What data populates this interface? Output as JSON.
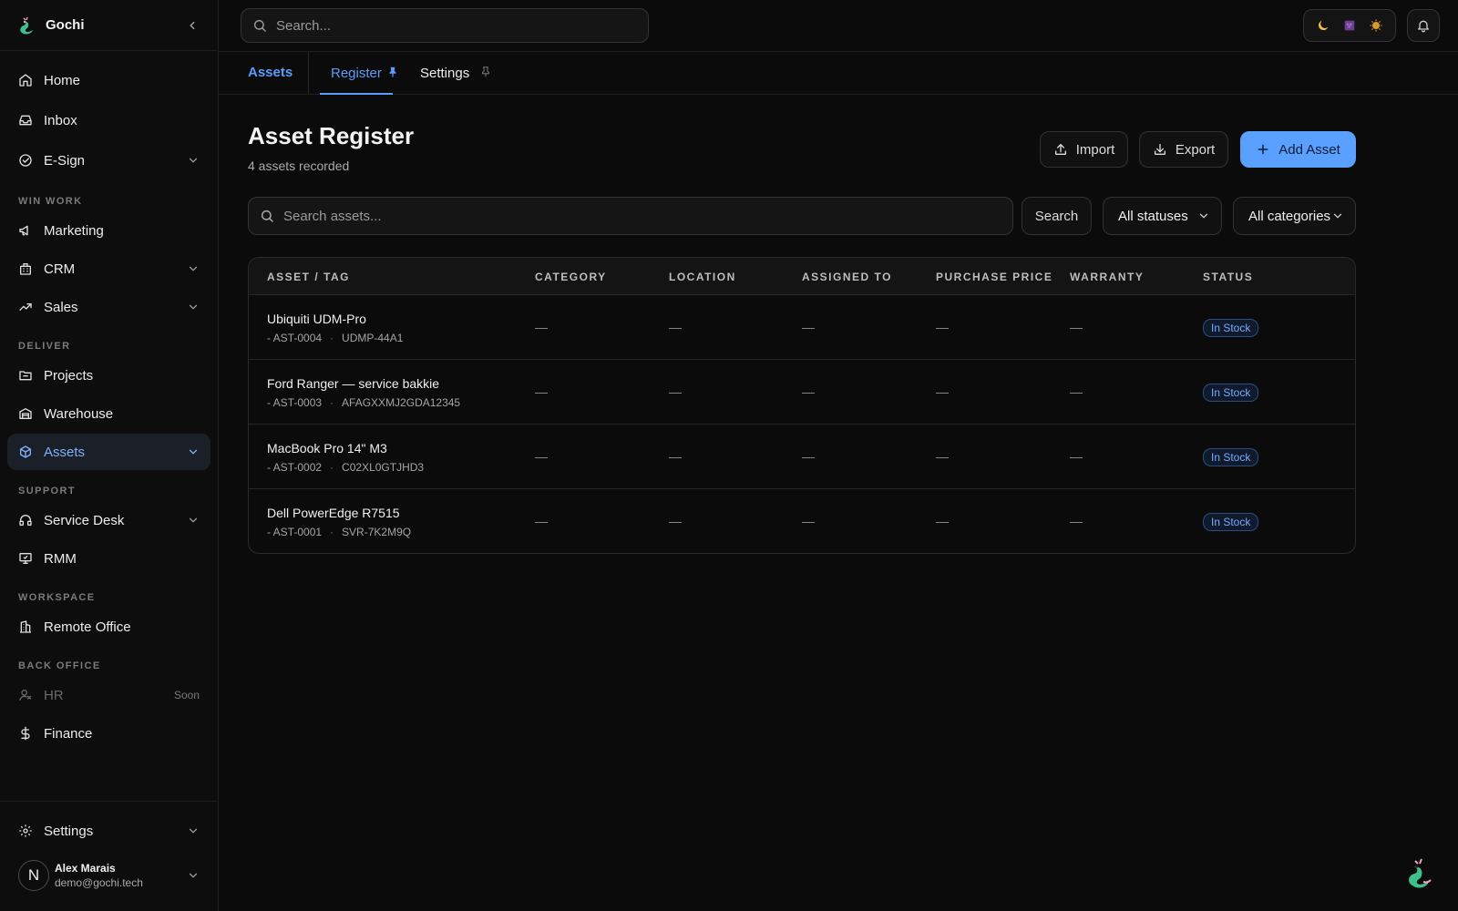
{
  "brand": {
    "name": "Gochi",
    "logo_icon": "dragon-logo-icon"
  },
  "sidebar": {
    "items": [
      {
        "label": "Home",
        "icon": "home-icon"
      },
      {
        "label": "Inbox",
        "icon": "inbox-icon"
      },
      {
        "label": "E-Sign",
        "icon": "check-circle-icon"
      },
      {
        "label": "Marketing",
        "icon": "megaphone-icon"
      },
      {
        "label": "CRM",
        "icon": "building-icon"
      },
      {
        "label": "Sales",
        "icon": "trending-up-icon"
      },
      {
        "label": "Projects",
        "icon": "folder-icon"
      },
      {
        "label": "Warehouse",
        "icon": "warehouse-icon"
      },
      {
        "label": "Assets",
        "icon": "box-icon"
      },
      {
        "label": "Service Desk",
        "icon": "headphones-icon"
      },
      {
        "label": "RMM",
        "icon": "monitor-icon"
      },
      {
        "label": "Remote Office",
        "icon": "office-building-icon"
      },
      {
        "label": "HR",
        "icon": "user-icon",
        "badge": "Soon"
      },
      {
        "label": "Finance",
        "icon": "dollar-icon"
      },
      {
        "label": "Settings",
        "icon": "gear-icon"
      }
    ],
    "sections": {
      "win_work": "WIN WORK",
      "deliver": "DELIVER",
      "support": "SUPPORT",
      "workspace": "WORKSPACE",
      "back_office": "BACK OFFICE"
    },
    "active_item": "Assets"
  },
  "user": {
    "initial": "N",
    "name": "Alex Marais",
    "email": "demo@gochi.tech"
  },
  "topbar": {
    "search_placeholder": "Search...",
    "theme_buttons": [
      "moon-icon",
      "grape-icon",
      "sun-icon"
    ],
    "bell_icon": "bell-icon"
  },
  "tabs": {
    "module": "Assets",
    "items": [
      {
        "label": "Register",
        "active": true,
        "pinned": true
      },
      {
        "label": "Settings",
        "active": false,
        "pinned": false
      }
    ]
  },
  "page": {
    "title": "Asset Register",
    "subtitle": "4 assets recorded",
    "import_label": "Import",
    "export_label": "Export",
    "add_label": "Add Asset"
  },
  "filters": {
    "search_placeholder": "Search assets...",
    "search_button": "Search",
    "status_select": "All statuses",
    "category_select": "All categories"
  },
  "table": {
    "columns": [
      "ASSET / TAG",
      "CATEGORY",
      "LOCATION",
      "ASSIGNED TO",
      "PURCHASE PRICE",
      "WARRANTY",
      "STATUS"
    ],
    "rows": [
      {
        "name": "Ubiquiti UDM-Pro",
        "id": "- AST-0004",
        "tag": "UDMP-44A1",
        "category": "—",
        "location": "—",
        "assigned_to": "—",
        "purchase_price": "—",
        "warranty": "—",
        "status": "In Stock"
      },
      {
        "name": "Ford Ranger — service bakkie",
        "id": "- AST-0003",
        "tag": "AFAGXXMJ2GDA12345",
        "category": "—",
        "location": "—",
        "assigned_to": "—",
        "purchase_price": "—",
        "warranty": "—",
        "status": "In Stock"
      },
      {
        "name": "MacBook Pro 14\" M3",
        "id": "- AST-0002",
        "tag": "C02XL0GTJHD3",
        "category": "—",
        "location": "—",
        "assigned_to": "—",
        "purchase_price": "—",
        "warranty": "—",
        "status": "In Stock"
      },
      {
        "name": "Dell PowerEdge R7515",
        "id": "- AST-0001",
        "tag": "SVR-7K2M9Q",
        "category": "—",
        "location": "—",
        "assigned_to": "—",
        "purchase_price": "—",
        "warranty": "—",
        "status": "In Stock"
      }
    ]
  },
  "colors": {
    "accent": "#5b9cff",
    "background": "#0b0b0b",
    "badge_text": "#78aaff"
  }
}
